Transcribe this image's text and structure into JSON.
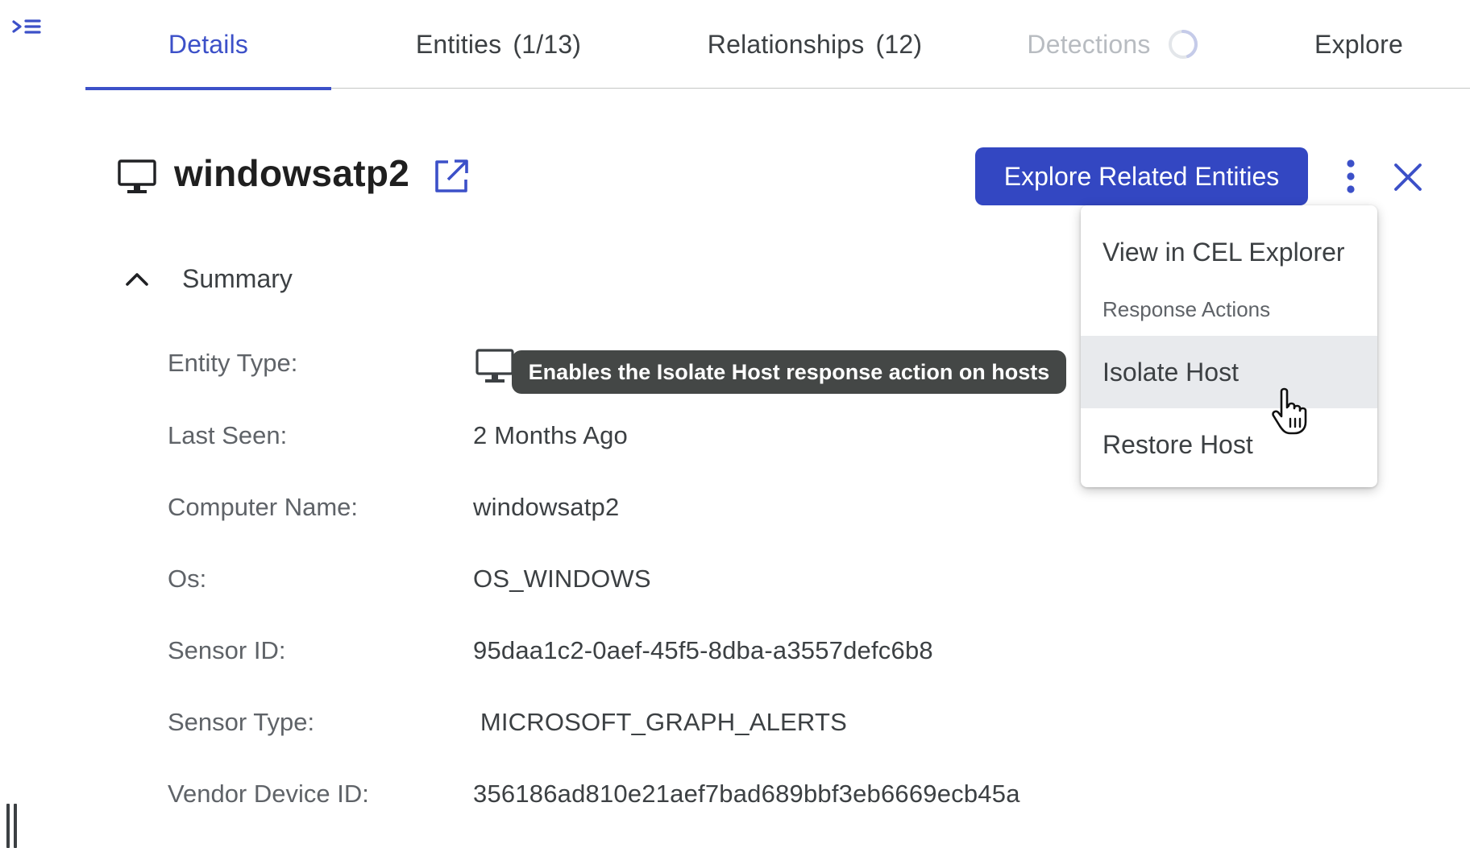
{
  "tabs": [
    {
      "label": "Details",
      "count": ""
    },
    {
      "label": "Entities",
      "count": "(1/13)"
    },
    {
      "label": "Relationships",
      "count": "(12)"
    },
    {
      "label": "Detections",
      "count": ""
    },
    {
      "label": "Explore",
      "count": ""
    }
  ],
  "header": {
    "title": "windowsatp2",
    "explore_button": "Explore Related Entities"
  },
  "summary": {
    "label": "Summary",
    "rows": [
      {
        "label": "Entity Type:",
        "value": ""
      },
      {
        "label": "Last Seen:",
        "value": "2 Months Ago"
      },
      {
        "label": "Computer Name:",
        "value": "windowsatp2"
      },
      {
        "label": "Os:",
        "value": "OS_WINDOWS"
      },
      {
        "label": "Sensor ID:",
        "value": "95daa1c2-0aef-45f5-8dba-a3557defc6b8"
      },
      {
        "label": "Sensor Type:",
        "value": " MICROSOFT_GRAPH_ALERTS"
      },
      {
        "label": "Vendor Device ID:",
        "value": "356186ad810e21aef7bad689bbf3eb6669ecb45a"
      }
    ]
  },
  "tooltip": {
    "text": "Enables the Isolate Host response action on hosts"
  },
  "menu": {
    "view_cel": "View in CEL Explorer",
    "section_header": "Response Actions",
    "isolate": "Isolate Host",
    "restore": "Restore Host"
  },
  "colors": {
    "accent": "#3347c2",
    "tab_active": "#3c50c8",
    "tooltip_bg": "#444746",
    "menu_hover": "#e8eaed"
  },
  "icons": {
    "rail_toggle": "expand-panel-icon",
    "entity": "monitor-icon",
    "open": "open-in-new-icon",
    "more": "more-vert-icon",
    "close": "close-icon",
    "collapse": "chevron-up-icon",
    "loading": "spinner-icon"
  }
}
